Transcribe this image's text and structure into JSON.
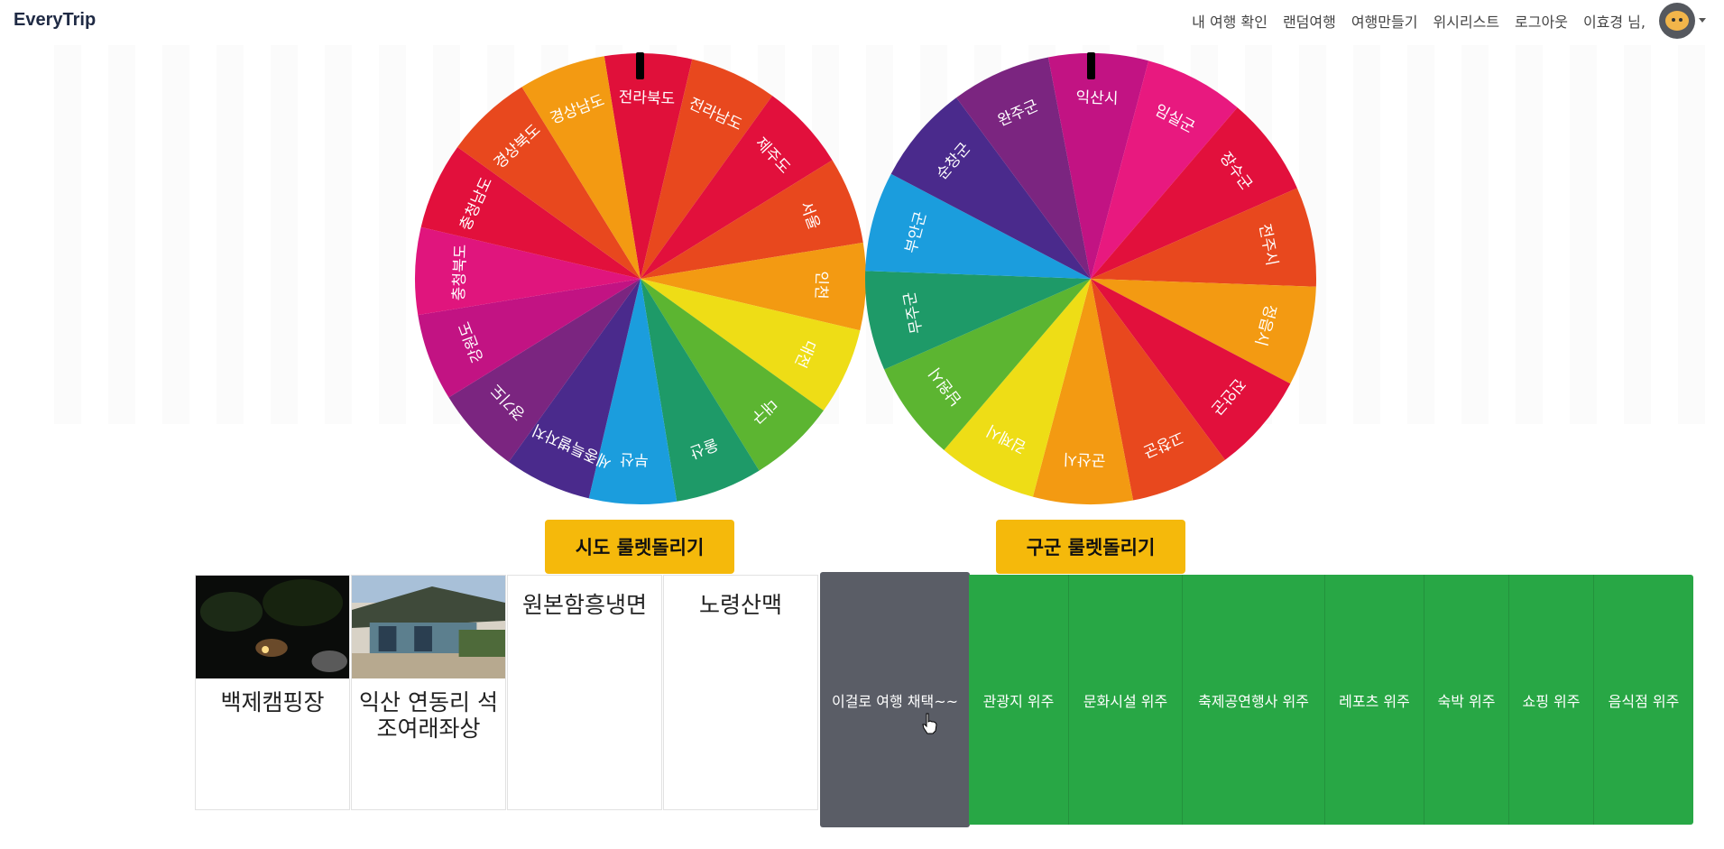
{
  "navbar": {
    "brand": "EveryTrip",
    "links": [
      "내 여행 확인",
      "랜덤여행",
      "여행만들기",
      "위시리스트",
      "로그아웃"
    ],
    "user": "이효경 님,"
  },
  "wheels": {
    "sido": {
      "labels": [
        "전라북도",
        "전라남도",
        "제주도",
        "서울",
        "인천",
        "대전",
        "대구",
        "울산",
        "부산",
        "세종특별자치시",
        "경기도",
        "강원도",
        "충청북도",
        "충청남도",
        "경상북도",
        "경상남도"
      ],
      "colors": [
        "#e0103a",
        "#e8481e",
        "#e2103c",
        "#e8481e",
        "#f39a12",
        "#eedd16",
        "#5cb531",
        "#1e9a68",
        "#1b9ddd",
        "#4a2a8c",
        "#7b2580",
        "#c21383",
        "#e0157d",
        "#e2103c",
        "#e8481e",
        "#f39a12",
        "#eedd16"
      ]
    },
    "gugun": {
      "labels": [
        "익산시",
        "임실군",
        "장수군",
        "전주시",
        "정읍시",
        "진안군",
        "고창군",
        "군산시",
        "김제시",
        "남원시",
        "무주군",
        "부안군",
        "순창군",
        "완주군"
      ],
      "colors": [
        "#c21383",
        "#e8197f",
        "#e2103c",
        "#e8481e",
        "#f39a12",
        "#e2103c",
        "#e8481e",
        "#f39a12",
        "#eedd16",
        "#5cb531",
        "#1e9a68",
        "#1b9ddd",
        "#4a2a8c",
        "#7b2580"
      ]
    }
  },
  "buttons": {
    "sido_spin": "시도 룰렛돌리기",
    "gugun_spin": "구군 룰렛돌리기",
    "pick": "이걸로 여행 채택~~"
  },
  "cards": [
    {
      "title": "백제캠핑장",
      "image": "night-forest-photo"
    },
    {
      "title": "익산 연동리 석조여래좌상",
      "image": "temple-photo"
    },
    {
      "title": "원본함흥냉면",
      "image": ""
    },
    {
      "title": "노령산맥",
      "image": ""
    }
  ],
  "categories": [
    "관광지 위주",
    "문화시설 위주",
    "축제공연행사 위주",
    "레포츠 위주",
    "숙박 위주",
    "쇼핑 위주",
    "음식점 위주"
  ]
}
